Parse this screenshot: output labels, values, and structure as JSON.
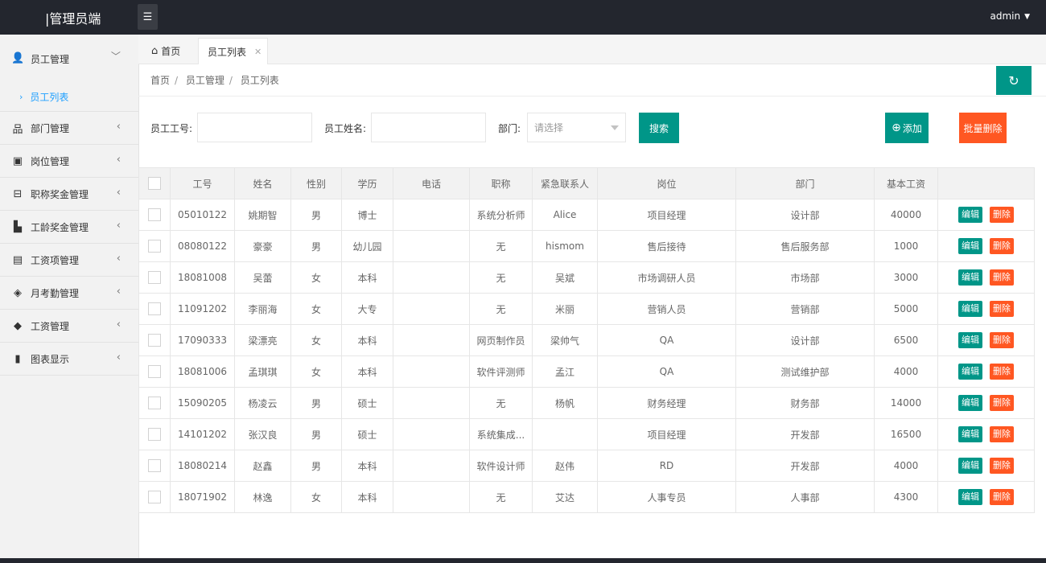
{
  "header": {
    "logo": "|管理员端",
    "menu_icon": "list-icon",
    "user": "admin"
  },
  "sidebar": {
    "items": [
      {
        "icon": "user-icon",
        "label": "员工管理",
        "open": true,
        "children": [
          {
            "label": "员工列表",
            "active": true
          }
        ]
      },
      {
        "icon": "sitemap-icon",
        "label": "部门管理"
      },
      {
        "icon": "id-badge-icon",
        "label": "岗位管理"
      },
      {
        "icon": "briefcase-icon",
        "label": "职称奖金管理"
      },
      {
        "icon": "building-icon",
        "label": "工龄奖金管理"
      },
      {
        "icon": "money-icon",
        "label": "工资项管理"
      },
      {
        "icon": "layers-icon",
        "label": "月考勤管理"
      },
      {
        "icon": "tag-icon",
        "label": "工资管理"
      },
      {
        "icon": "document-icon",
        "label": "图表显示"
      }
    ]
  },
  "tabs": [
    {
      "label": "首页",
      "icon": "home-icon"
    },
    {
      "label": "员工列表",
      "active": true
    }
  ],
  "breadcrumb": [
    "首页",
    "员工管理",
    "员工列表"
  ],
  "search": {
    "emp_no_label": "员工工号:",
    "emp_name_label": "员工姓名:",
    "dept_label": "部门:",
    "dept_placeholder": "请选择",
    "search_button": "搜索",
    "add_button": "添加",
    "batch_delete_button": "批量删除"
  },
  "table": {
    "columns": [
      "工号",
      "姓名",
      "性别",
      "学历",
      "电话",
      "职称",
      "紧急联系人",
      "岗位",
      "部门",
      "基本工资"
    ],
    "edit_label": "编辑",
    "delete_label": "删除",
    "rows": [
      [
        "05010122",
        "姚期智",
        "男",
        "博士",
        "",
        "系统分析师",
        "Alice",
        "项目经理",
        "设计部",
        "40000"
      ],
      [
        "08080122",
        "豪豪",
        "男",
        "幼儿园",
        "",
        "无",
        "hismom",
        "售后接待",
        "售后服务部",
        "1000"
      ],
      [
        "18081008",
        "吴蕾",
        "女",
        "本科",
        "",
        "无",
        "吴斌",
        "市场调研人员",
        "市场部",
        "3000"
      ],
      [
        "11091202",
        "李丽海",
        "女",
        "大专",
        "",
        "无",
        "米丽",
        "营销人员",
        "营销部",
        "5000"
      ],
      [
        "17090333",
        "梁漂亮",
        "女",
        "本科",
        "",
        "网页制作员",
        "梁帅气",
        "QA",
        "设计部",
        "6500"
      ],
      [
        "18081006",
        "孟琪琪",
        "女",
        "本科",
        "",
        "软件评测师",
        "孟江",
        "QA",
        "测试维护部",
        "4000"
      ],
      [
        "15090205",
        "杨凌云",
        "男",
        "硕士",
        "",
        "无",
        "杨帆",
        "财务经理",
        "财务部",
        "14000"
      ],
      [
        "14101202",
        "张汉良",
        "男",
        "硕士",
        "",
        "系统集成...",
        "",
        "项目经理",
        "开发部",
        "16500"
      ],
      [
        "18080214",
        "赵鑫",
        "男",
        "本科",
        "",
        "软件设计师",
        "赵伟",
        "RD",
        "开发部",
        "4000"
      ],
      [
        "18071902",
        "林逸",
        "女",
        "本科",
        "",
        "无",
        "艾达",
        "人事专员",
        "人事部",
        "4300"
      ]
    ]
  }
}
